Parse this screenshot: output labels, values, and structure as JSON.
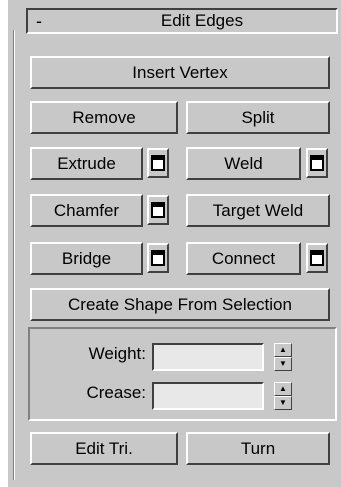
{
  "rollout": {
    "collapse_symbol": "-",
    "title": "Edit Edges"
  },
  "buttons": {
    "insert_vertex": "Insert Vertex",
    "remove": "Remove",
    "split": "Split",
    "extrude": "Extrude",
    "weld": "Weld",
    "chamfer": "Chamfer",
    "target_weld": "Target Weld",
    "bridge": "Bridge",
    "connect": "Connect",
    "create_shape": "Create Shape From Selection",
    "edit_tri": "Edit Tri.",
    "turn": "Turn"
  },
  "params": {
    "weight_label": "Weight:",
    "weight_value": "",
    "crease_label": "Crease:",
    "crease_value": ""
  },
  "icons": {
    "settings_icon": "window-settings-icon",
    "spinner_up": "▲",
    "spinner_down": "▼"
  }
}
